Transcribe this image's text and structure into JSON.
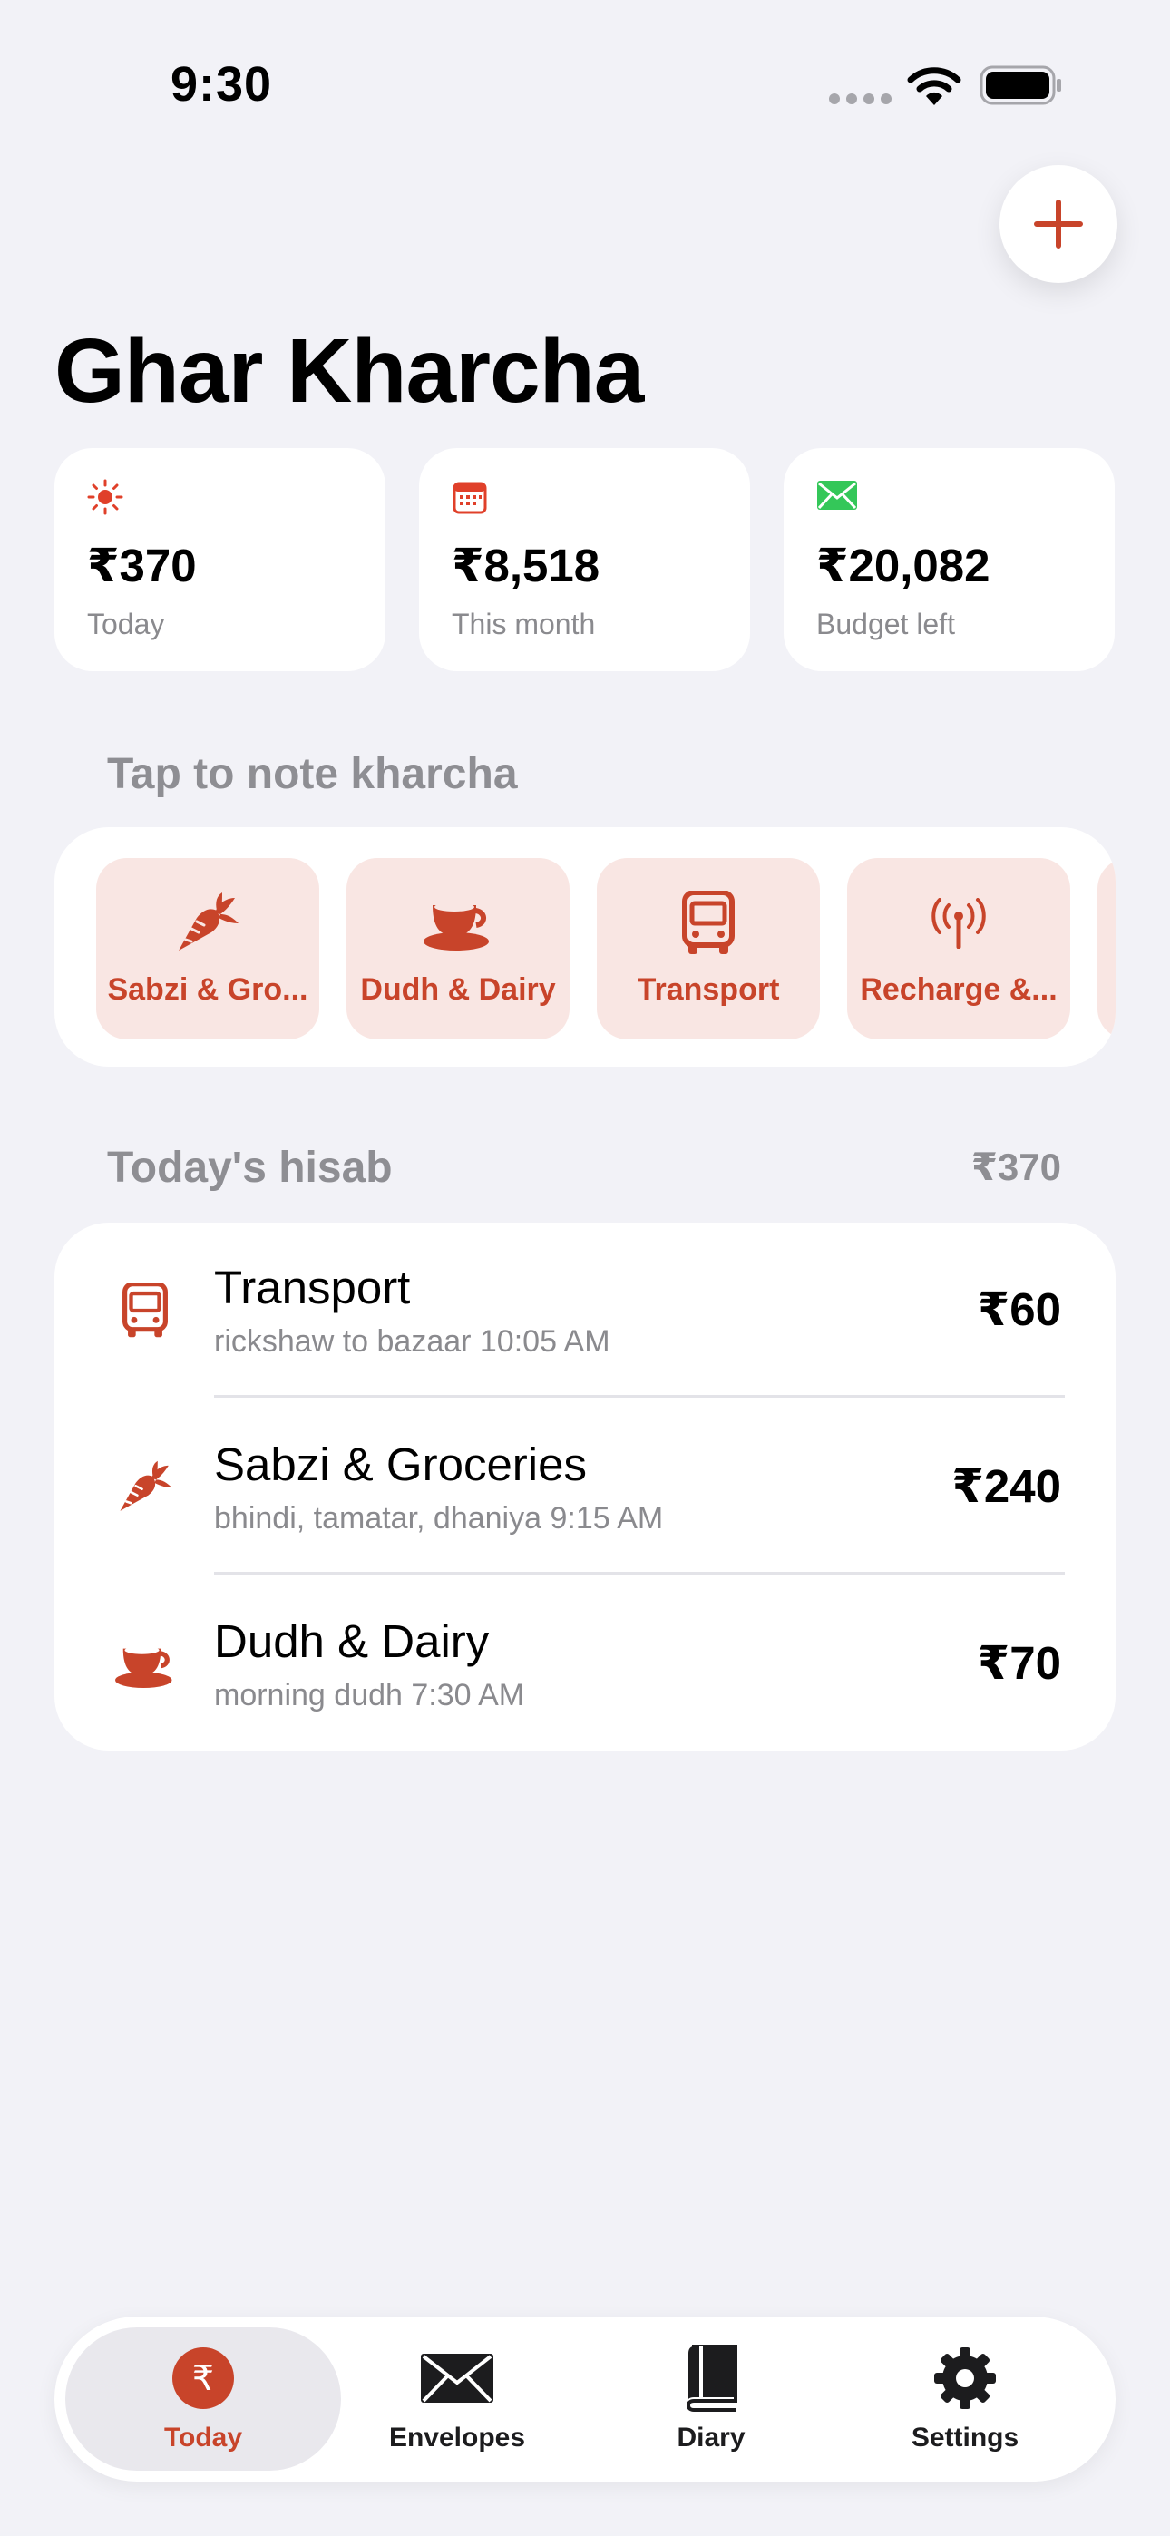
{
  "status_bar": {
    "time": "9:30"
  },
  "header": {
    "title": "Ghar Kharcha",
    "add_icon": "plus-icon"
  },
  "summary": [
    {
      "icon": "sun-icon",
      "amount": "₹370",
      "caption": "Today"
    },
    {
      "icon": "calendar-icon",
      "amount": "₹8,518",
      "caption": "This month"
    },
    {
      "icon": "envelope-icon",
      "amount": "₹20,082",
      "caption": "Budget left"
    }
  ],
  "quick_add": {
    "heading": "Tap to note kharcha",
    "tiles": [
      {
        "icon": "carrot-icon",
        "label": "Sabzi & Gro..."
      },
      {
        "icon": "cup-icon",
        "label": "Dudh & Dairy"
      },
      {
        "icon": "bus-icon",
        "label": "Transport"
      },
      {
        "icon": "antenna-icon",
        "label": "Recharge &..."
      }
    ]
  },
  "hisab": {
    "heading": "Today's hisab",
    "total": "₹370",
    "rows": [
      {
        "icon": "bus-icon",
        "title": "Transport",
        "subtitle": "rickshaw to bazaar  10:05 AM",
        "amount": "₹60"
      },
      {
        "icon": "carrot-icon",
        "title": "Sabzi & Groceries",
        "subtitle": "bhindi, tamatar, dhaniya  9:15 AM",
        "amount": "₹240"
      },
      {
        "icon": "cup-icon",
        "title": "Dudh & Dairy",
        "subtitle": "morning dudh  7:30 AM",
        "amount": "₹70"
      }
    ]
  },
  "tab_bar": {
    "tabs": [
      {
        "icon": "rupee-circle-icon",
        "label": "Today",
        "active": true
      },
      {
        "icon": "envelope-icon",
        "label": "Envelopes",
        "active": false
      },
      {
        "icon": "book-icon",
        "label": "Diary",
        "active": false
      },
      {
        "icon": "gear-icon",
        "label": "Settings",
        "active": false
      }
    ]
  },
  "colors": {
    "accent": "#c8442a",
    "tile_background": "#f9e6e3",
    "positive": "#34c759",
    "background": "#f2f2f7",
    "secondary_text": "#8a8a8e"
  }
}
